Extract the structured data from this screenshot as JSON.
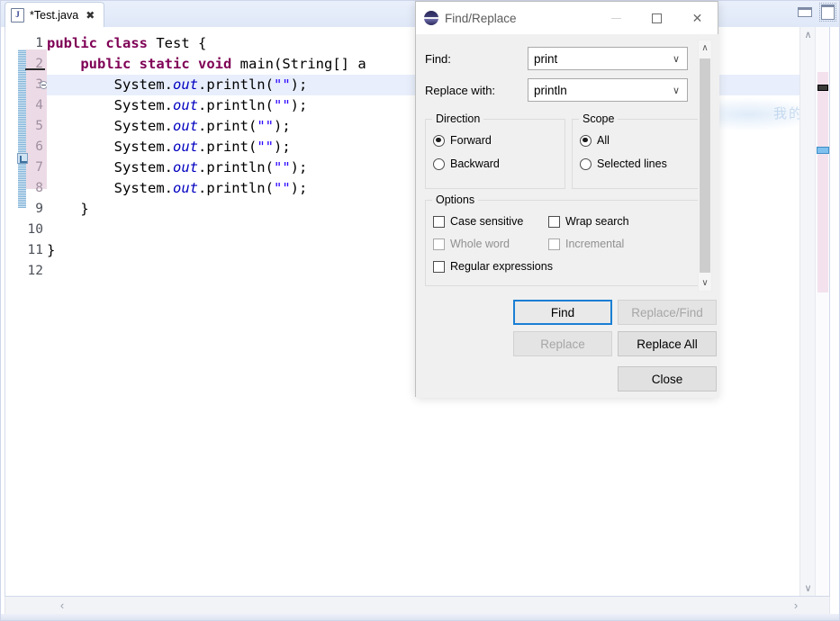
{
  "editor": {
    "tab": {
      "title": "*Test.java",
      "file_icon": "java-file-icon",
      "close_icon": "✖"
    },
    "view_buttons": {
      "minimize": "minimize-view-icon",
      "maximize": "maximize-view-icon"
    },
    "watermark_text": "我的笔",
    "gutter_numbers": [
      "1",
      "2",
      "3",
      "4",
      "5",
      "6",
      "7",
      "8",
      "9",
      "10",
      "11",
      "12"
    ],
    "lines": [
      {
        "n": "1",
        "indent": 0,
        "tokens": [
          {
            "t": "public",
            "c": "kw"
          },
          {
            "t": " ",
            "c": ""
          },
          {
            "t": "class",
            "c": "kw"
          },
          {
            "t": " Test {",
            "c": ""
          }
        ]
      },
      {
        "n": "2",
        "indent": 0,
        "tokens": [
          {
            "t": "    ",
            "c": ""
          },
          {
            "t": "public",
            "c": "kw"
          },
          {
            "t": " ",
            "c": ""
          },
          {
            "t": "static",
            "c": "kw"
          },
          {
            "t": " ",
            "c": ""
          },
          {
            "t": "void",
            "c": "kw"
          },
          {
            "t": " main(String[] a",
            "c": ""
          }
        ]
      },
      {
        "n": "3",
        "indent": 0,
        "tokens": [
          {
            "t": "        System.",
            "c": ""
          },
          {
            "t": "out",
            "c": "fld"
          },
          {
            "t": ".println(",
            "c": ""
          },
          {
            "t": "\"\"",
            "c": "str"
          },
          {
            "t": ");",
            "c": ""
          }
        ]
      },
      {
        "n": "4",
        "indent": 0,
        "tokens": [
          {
            "t": "        System.",
            "c": ""
          },
          {
            "t": "out",
            "c": "fld"
          },
          {
            "t": ".println(",
            "c": ""
          },
          {
            "t": "\"\"",
            "c": "str"
          },
          {
            "t": ");",
            "c": ""
          }
        ]
      },
      {
        "n": "5",
        "indent": 0,
        "tokens": [
          {
            "t": "        System.",
            "c": ""
          },
          {
            "t": "out",
            "c": "fld"
          },
          {
            "t": ".print(",
            "c": ""
          },
          {
            "t": "\"\"",
            "c": "str"
          },
          {
            "t": ");",
            "c": ""
          }
        ]
      },
      {
        "n": "6",
        "indent": 0,
        "tokens": [
          {
            "t": "        System.",
            "c": ""
          },
          {
            "t": "out",
            "c": "fld"
          },
          {
            "t": ".print(",
            "c": ""
          },
          {
            "t": "\"\"",
            "c": "str"
          },
          {
            "t": ");",
            "c": ""
          }
        ]
      },
      {
        "n": "7",
        "indent": 0,
        "tokens": [
          {
            "t": "        System.",
            "c": ""
          },
          {
            "t": "out",
            "c": "fld"
          },
          {
            "t": ".println(",
            "c": ""
          },
          {
            "t": "\"\"",
            "c": "str"
          },
          {
            "t": ");",
            "c": ""
          }
        ]
      },
      {
        "n": "8",
        "indent": 0,
        "tokens": [
          {
            "t": "        System.",
            "c": ""
          },
          {
            "t": "out",
            "c": "fld"
          },
          {
            "t": ".println(",
            "c": ""
          },
          {
            "t": "\"\"",
            "c": "str"
          },
          {
            "t": ");",
            "c": ""
          }
        ]
      },
      {
        "n": "9",
        "indent": 0,
        "tokens": [
          {
            "t": "    }",
            "c": ""
          }
        ]
      },
      {
        "n": "10",
        "indent": 0,
        "tokens": [
          {
            "t": "",
            "c": ""
          }
        ]
      },
      {
        "n": "11",
        "indent": 0,
        "tokens": [
          {
            "t": "}",
            "c": ""
          }
        ]
      },
      {
        "n": "12",
        "indent": 0,
        "tokens": [
          {
            "t": "",
            "c": ""
          }
        ]
      }
    ],
    "current_line": 3,
    "scroll": {
      "up_arrow": "∧",
      "down_arrow": "∨",
      "left_arrow": "‹",
      "right_arrow": "›"
    }
  },
  "dialog": {
    "title": "Find/Replace",
    "logo": "eclipse-logo",
    "window_buttons": {
      "minimize": "–",
      "maximize": "□",
      "close": "✕"
    },
    "find": {
      "label": "Find:",
      "value": "print",
      "arrow": "∨"
    },
    "replace": {
      "label": "Replace with:",
      "value": "println",
      "arrow": "∨"
    },
    "direction": {
      "title": "Direction",
      "options": [
        {
          "label": "Forward",
          "checked": true
        },
        {
          "label": "Backward",
          "checked": false
        }
      ]
    },
    "scope": {
      "title": "Scope",
      "options": [
        {
          "label": "All",
          "checked": true
        },
        {
          "label": "Selected lines",
          "checked": false
        }
      ]
    },
    "options": {
      "title": "Options",
      "items": [
        {
          "label": "Case sensitive",
          "checked": false,
          "enabled": true
        },
        {
          "label": "Wrap search",
          "checked": false,
          "enabled": true
        },
        {
          "label": "Whole word",
          "checked": false,
          "enabled": false
        },
        {
          "label": "Incremental",
          "checked": false,
          "enabled": false
        },
        {
          "label": "Regular expressions",
          "checked": false,
          "enabled": true
        }
      ]
    },
    "buttons": {
      "find": {
        "label": "Find",
        "state": "focused"
      },
      "replace_find": {
        "label": "Replace/Find",
        "state": "disabled"
      },
      "replace": {
        "label": "Replace",
        "state": "disabled"
      },
      "replace_all": {
        "label": "Replace All",
        "state": "normal"
      },
      "close": {
        "label": "Close",
        "state": "normal"
      }
    },
    "scrollbar": {
      "up_arrow": "∧",
      "down_arrow": "∨"
    }
  },
  "colors": {
    "keyword": "#7f0055",
    "field": "#0000c0",
    "string": "#2a00ff",
    "current_line": "#e8eefb",
    "focus_border": "#1a7fd4"
  }
}
